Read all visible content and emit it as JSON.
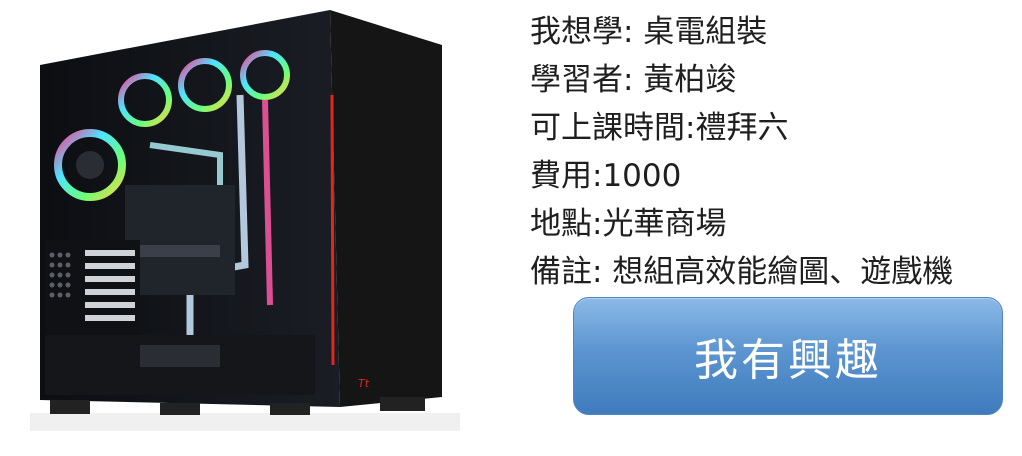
{
  "listing": {
    "lines": [
      "我想學: 桌電組裝",
      "學習者: 黃柏竣",
      "可上課時間:禮拜六",
      "費用:1000",
      "地點:光華商場",
      "備註: 想組高效能繪圖、遊戲機"
    ],
    "cta_label": "我有興趣"
  },
  "colors": {
    "cta_top": "#8bb9e7",
    "cta_bottom": "#3f7bbd",
    "case_accent": "#e0261d"
  }
}
